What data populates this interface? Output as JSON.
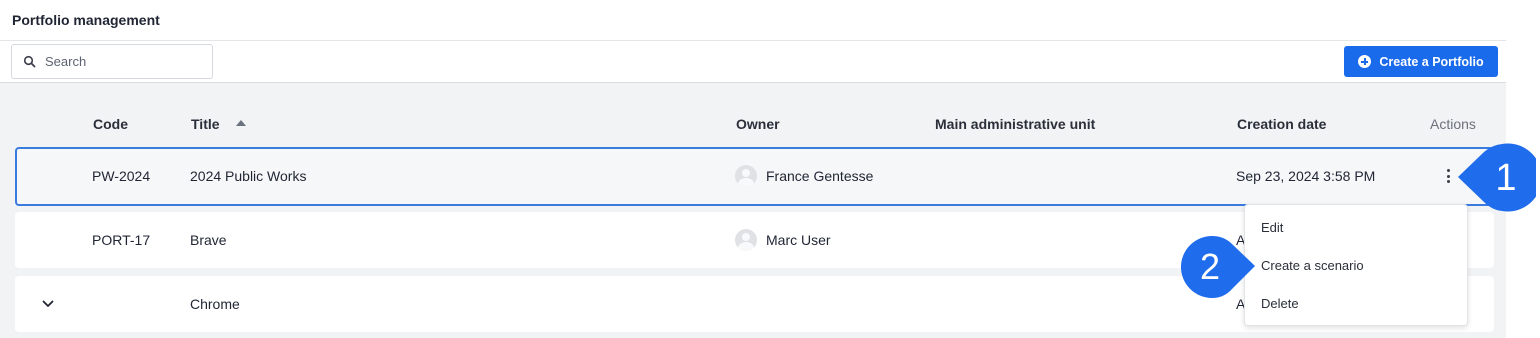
{
  "header": {
    "title": "Portfolio management"
  },
  "toolbar": {
    "search_placeholder": "Search",
    "create_label": "Create a Portfolio"
  },
  "table": {
    "columns": {
      "code": "Code",
      "title": "Title",
      "owner": "Owner",
      "unit": "Main administrative unit",
      "created": "Creation date",
      "actions": "Actions"
    },
    "rows": [
      {
        "code": "PW-2024",
        "title": "2024 Public Works",
        "owner": "France Gentesse",
        "created": "Sep 23, 2024 3:58 PM"
      },
      {
        "code": "PORT-17",
        "title": "Brave",
        "owner": "Marc User",
        "created": "A"
      },
      {
        "code": "",
        "title": "Chrome",
        "owner": "",
        "created": "A"
      }
    ]
  },
  "menu": {
    "items": [
      "Edit",
      "Create a scenario",
      "Delete"
    ]
  },
  "callouts": [
    "1",
    "2"
  ],
  "colors": {
    "accent": "#1a6bec",
    "callout": "#1f6cec",
    "selected_border": "#3a7be0"
  }
}
